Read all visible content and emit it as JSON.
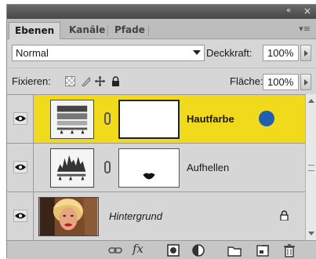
{
  "titlebar": {
    "collapse_glyph": "«",
    "collapse_icon": "double-chevron-left-icon",
    "close_glyph": "×",
    "close_icon": "close-icon"
  },
  "tabs": [
    {
      "label": "Ebenen",
      "active": true
    },
    {
      "label": "Kanäle",
      "active": false
    },
    {
      "label": "Pfade",
      "active": false
    }
  ],
  "panel_menu_glyph": "▾≡",
  "blend_mode": {
    "value": "Normal"
  },
  "opacity": {
    "label": "Deckkraft:",
    "value": "100%"
  },
  "lock": {
    "label": "Fixieren:",
    "icons": [
      "lock-transparent-pixels-icon",
      "lock-image-pixels-icon",
      "lock-position-icon",
      "lock-all-icon"
    ]
  },
  "fill": {
    "label": "Fläche:",
    "value": "100%"
  },
  "layers": [
    {
      "name": "Hautfarbe",
      "type": "adjustment-levels",
      "selected": true,
      "visible": true,
      "bold": true,
      "badge_color": "#1f5fb0"
    },
    {
      "name": "Aufhellen",
      "type": "adjustment-curves",
      "selected": false,
      "visible": true,
      "bold": false
    },
    {
      "name": "Hintergrund",
      "type": "background",
      "selected": false,
      "visible": true,
      "italic": true,
      "locked": true
    }
  ],
  "footer_icons": [
    "link-layers-icon",
    "fx-icon",
    "add-mask-icon",
    "new-adjustment-icon",
    "new-group-icon",
    "new-layer-icon",
    "trash-icon"
  ],
  "fx_label": "fx",
  "colors": {
    "selected_row": "#f0da1b",
    "panel_bg": "#d6d6d6",
    "badge": "#1f5fb0"
  }
}
